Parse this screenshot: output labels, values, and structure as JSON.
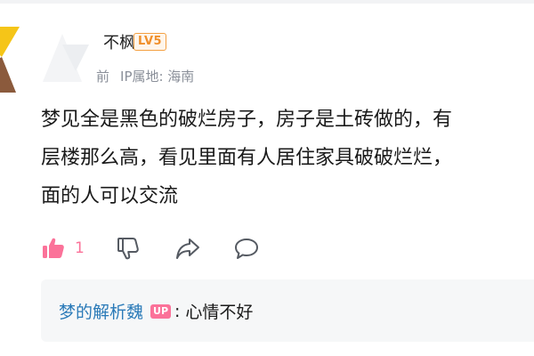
{
  "comment": {
    "username": "不枫",
    "level_badge": "LV5",
    "time": "前",
    "ip_location": "IP属地: 海南",
    "body_lines": [
      "梦见全是黑色的破烂房子，房子是土砖做的，有",
      "层楼那么高，看见里面有人居住家具破破烂烂，",
      "面的人可以交流"
    ],
    "like_count": "1"
  },
  "reply": {
    "author": "梦的解析魏",
    "badge": "UP",
    "separator": ":",
    "text": "心情不好"
  },
  "icons": {
    "like": "thumbs-up-icon",
    "dislike": "thumbs-down-icon",
    "share": "share-icon",
    "reply": "comment-icon"
  },
  "colors": {
    "accent_pink": "#fb7299",
    "reply_author_blue": "#2a7ab8",
    "level_orange": "#f08f2a",
    "avatar_yellow": "#f5c518",
    "avatar_brown": "#8b5a3c",
    "meta_gray": "#8a8f99"
  }
}
